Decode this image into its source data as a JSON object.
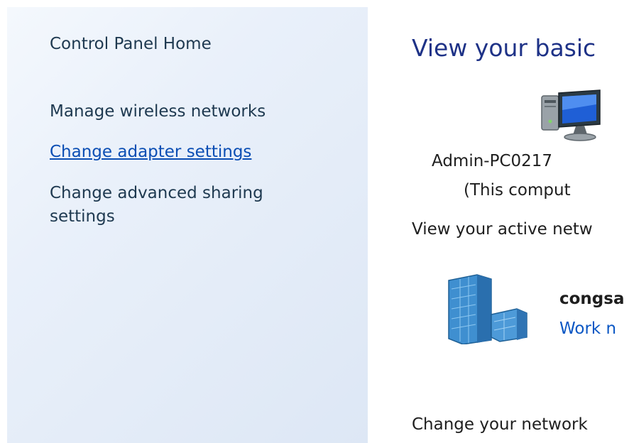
{
  "sidebar": {
    "items": [
      {
        "label": "Control Panel Home"
      },
      {
        "label": "Manage wireless networks"
      },
      {
        "label": "Change adapter settings"
      },
      {
        "label": "Change advanced sharing settings"
      }
    ]
  },
  "main": {
    "title": "View your basic",
    "computer": {
      "icon": "computer-icon",
      "name": "Admin-PC0217",
      "sub": "(This comput"
    },
    "active_networks_heading": "View your active netw",
    "network": {
      "icon": "network-building-icon",
      "name": "congsa",
      "type_link": "Work n"
    },
    "change_heading": "Change your network"
  },
  "colors": {
    "link": "#0b4eb4",
    "title": "#1e3287",
    "sidebar_bg": "#e6eef9"
  }
}
